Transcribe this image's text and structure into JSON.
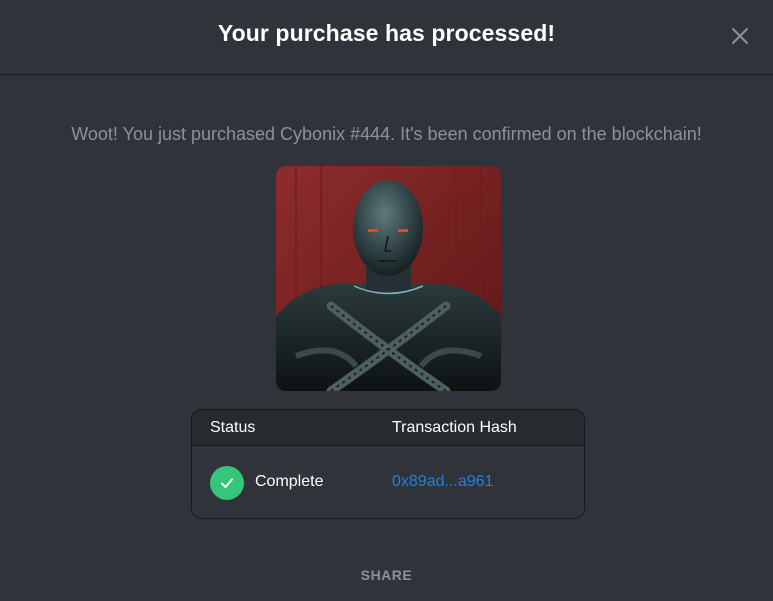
{
  "modal": {
    "title": "Your purchase has processed!",
    "close_icon": "close-icon",
    "subtitle": "Woot! You just purchased Cybonix #444. It's been confirmed on the blockchain!"
  },
  "nft": {
    "image_icon": "cyborg-portrait-image"
  },
  "transaction": {
    "headers": {
      "status": "Status",
      "hash": "Transaction Hash"
    },
    "row": {
      "status": "Complete",
      "status_icon": "checkmark-icon",
      "hash": "0x89ad...a961"
    }
  },
  "actions": {
    "share_label": "SHARE"
  },
  "colors": {
    "background": "#303339",
    "header_row": "#262b2f",
    "success": "#34c77b",
    "link": "#2081e2",
    "muted_text": "#8a939b"
  }
}
